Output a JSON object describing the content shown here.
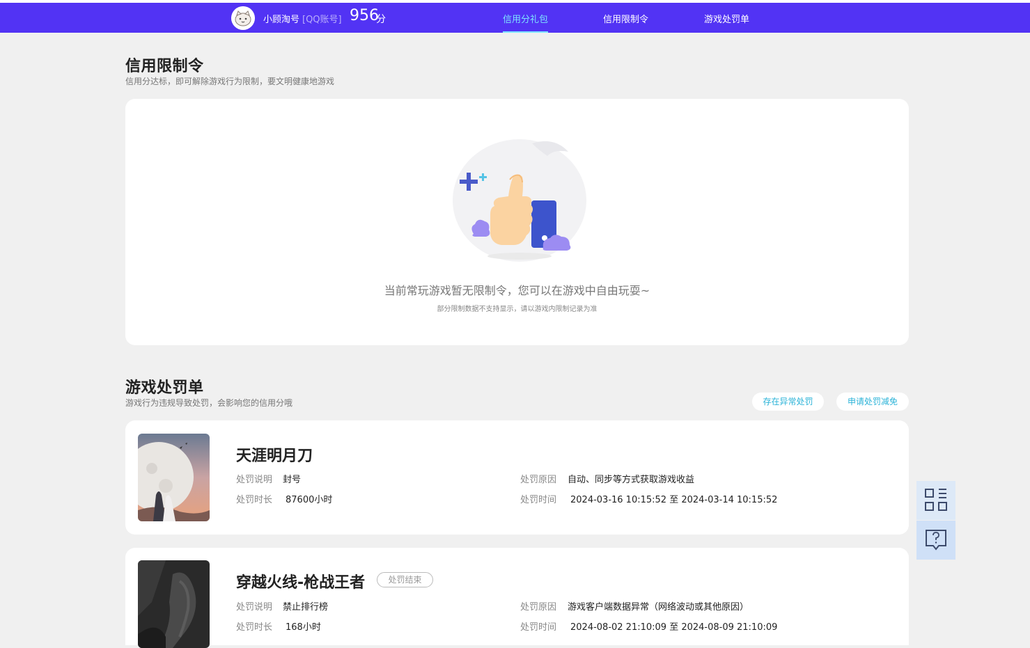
{
  "header": {
    "nickname": "小顾淘号",
    "account_type": "[QQ账号]",
    "score": "956",
    "score_unit": "分",
    "nav": [
      {
        "label": "信用分礼包",
        "active": true
      },
      {
        "label": "信用限制令",
        "active": false
      },
      {
        "label": "游戏处罚单",
        "active": false
      }
    ]
  },
  "restriction": {
    "title": "信用限制令",
    "subtitle": "信用分达标，即可解除游戏行为限制，要文明健康地游戏",
    "empty_text": "当前常玩游戏暂无限制令，您可以在游戏中自由玩耍~",
    "empty_subtext": "部分限制数据不支持显示，请以游戏内限制记录为准"
  },
  "penalty": {
    "title": "游戏处罚单",
    "subtitle": "游戏行为违规导致处罚，会影响您的信用分哦",
    "abnormal_button": "存在异常处罚",
    "appeal_button": "申请处罚减免",
    "labels": {
      "desc": "处罚说明",
      "duration": "处罚时长",
      "reason": "处罚原因",
      "time": "处罚时间"
    },
    "items": [
      {
        "game": "天涯明月刀",
        "status": "",
        "desc": "封号",
        "duration": "87600小时",
        "reason": "自动、同步等方式获取游戏收益",
        "time": "2024-03-16 10:15:52 至 2024-03-14 10:15:52"
      },
      {
        "game": "穿越火线-枪战王者",
        "status": "处罚结束",
        "desc": "禁止排行榜",
        "duration": "168小时",
        "reason": "游戏客户端数据异常（网络波动或其他原因）",
        "time": "2024-08-02 21:10:09 至 2024-08-09 21:10:09"
      }
    ]
  },
  "side_panel": {
    "icons": [
      "qr-code-icon",
      "help-message-icon"
    ]
  },
  "colors": {
    "header_bg": "#5233f4",
    "nav_active": "#7de3ff",
    "accent_link": "#2bb3d8",
    "page_bg": "#f0f0f0"
  }
}
